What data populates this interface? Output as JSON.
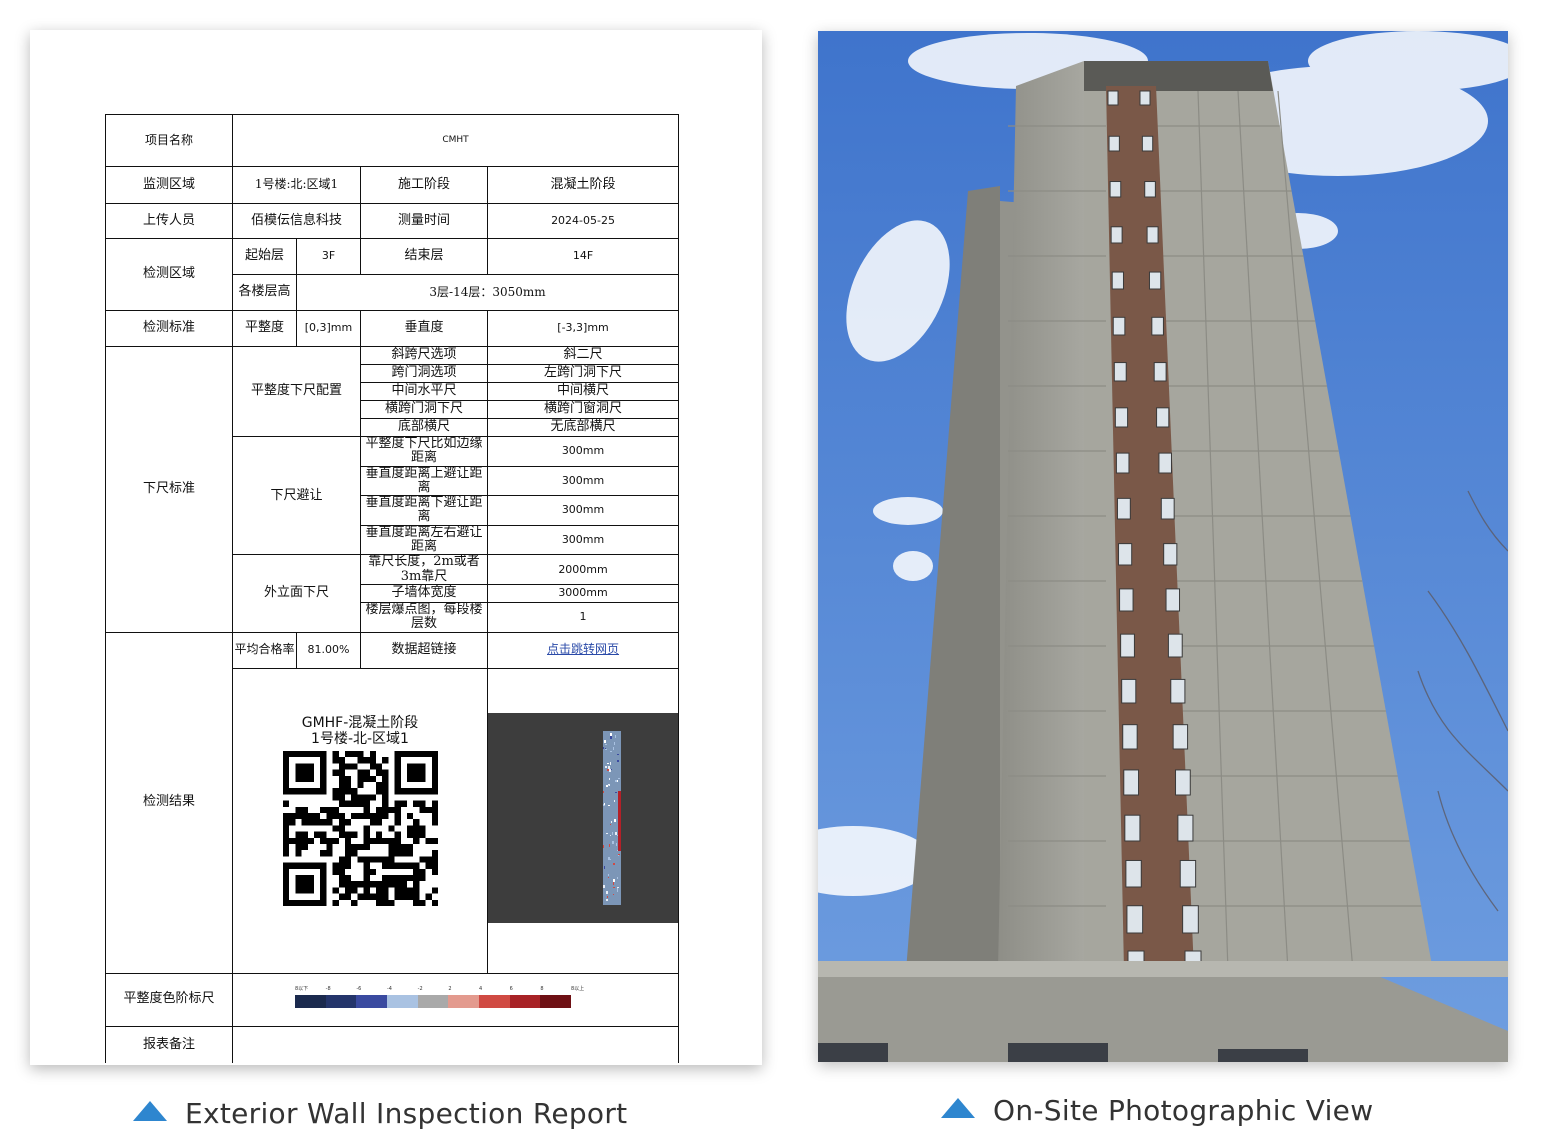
{
  "report": {
    "rows": {
      "project_name_label": "项目名称",
      "project_name_value": "CMHT",
      "monitor_area_label": "监测区域",
      "monitor_area_value": "1号楼:北:区域1",
      "construction_stage_label": "施工阶段",
      "construction_stage_value": "混凝土阶段",
      "uploader_label": "上传人员",
      "uploader_value": "佰模伝信息科技",
      "measure_time_label": "测量时间",
      "measure_time_value": "2024-05-25",
      "detect_area_label": "检测区域",
      "start_floor_label": "起始层",
      "start_floor_value": "3F",
      "end_floor_label": "结束层",
      "end_floor_value": "14F",
      "floor_height_label": "各楼层高",
      "floor_height_value": "3层-14层：3050mm",
      "detect_standard_label": "检测标准",
      "flatness_label": "平整度",
      "flatness_value": "[0,3]mm",
      "verticality_label": "垂直度",
      "verticality_value": "[-3,3]mm",
      "ruler_standard_label": "下尺标准",
      "ruler_config_label": "平整度下尺配置",
      "ruler_avoid_label": "下尺避让",
      "facade_ruler_label": "外立面下尺",
      "ruler_items": [
        {
          "name": "斜跨尺选项",
          "value": "斜二尺"
        },
        {
          "name": "跨门洞选项",
          "value": "左跨门洞下尺"
        },
        {
          "name": "中间水平尺",
          "value": "中间横尺"
        },
        {
          "name": "横跨门洞下尺",
          "value": "横跨门窗洞尺"
        },
        {
          "name": "底部横尺",
          "value": "无底部横尺"
        },
        {
          "name": "平整度下尺比如边缘距离",
          "value": "300mm"
        },
        {
          "name": "垂直度距离上避让距离",
          "value": "300mm"
        },
        {
          "name": "垂直度距离下避让距离",
          "value": "300mm"
        },
        {
          "name": "垂直度距离左右避让距离",
          "value": "300mm"
        },
        {
          "name": "靠尺长度，2m或者3m靠尺",
          "value": "2000mm"
        },
        {
          "name": "子墙体宽度",
          "value": "3000mm"
        },
        {
          "name": "楼层爆点图，每段楼层数",
          "value": "1"
        }
      ],
      "result_label": "检测结果",
      "avg_pass_label": "平均合格率",
      "avg_pass_value": "81.00%",
      "data_link_label": "数据超链接",
      "data_link_value": "点击跳转网页",
      "qr_title_line1": "GMHF-混凝土阶段",
      "qr_title_line2": "1号楼-北-区域1",
      "color_scale_label": "平整度色阶标尺",
      "color_scale_ticks": [
        "8以下",
        "-8",
        "-6",
        "-4",
        "-2",
        "2",
        "4",
        "6",
        "8",
        "8以上"
      ],
      "color_scale_colors": [
        "#1b2a4e",
        "#24356b",
        "#3a4aa0",
        "#a9c2e2",
        "#a9a9a9",
        "#e39a8e",
        "#d04a43",
        "#a82226",
        "#6e1014"
      ],
      "remarks_label": "报表备注",
      "remarks_value": ""
    }
  },
  "captions": {
    "left": "Exterior Wall Inspection Report",
    "right": "On-Site Photographic View"
  },
  "colors": {
    "caption_triangle": "#2e86cf",
    "sky": "#4a7fd0",
    "facade": "#a3a39c",
    "window_strip": "#7d5a4a"
  }
}
